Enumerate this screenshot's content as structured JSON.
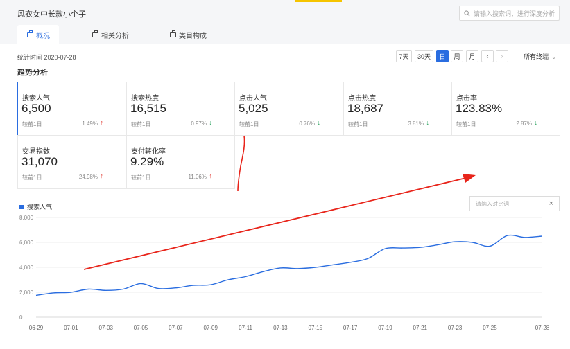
{
  "header": {
    "title": "风衣女中长款小个子",
    "search_placeholder": "请输入搜索词，进行深度分析"
  },
  "tabs": [
    {
      "label": "概况",
      "active": true
    },
    {
      "label": "相关分析",
      "active": false
    },
    {
      "label": "类目构成",
      "active": false
    }
  ],
  "datebar": {
    "stat_time": "统计时间 2020-07-28",
    "buttons": [
      "7天",
      "30天",
      "日",
      "周",
      "月"
    ],
    "active_button": "日",
    "prev": "‹",
    "next": "›",
    "terminal": "所有终端"
  },
  "section_title": "趋势分析",
  "cards": [
    {
      "label": "搜索人气",
      "value": "6,500",
      "cmp": "较前1日",
      "pct": "1.49%",
      "dir": "up",
      "selected": true
    },
    {
      "label": "搜索热度",
      "value": "16,515",
      "cmp": "较前1日",
      "pct": "0.97%",
      "dir": "down"
    },
    {
      "label": "点击人气",
      "value": "5,025",
      "cmp": "较前1日",
      "pct": "0.76%",
      "dir": "down"
    },
    {
      "label": "点击热度",
      "value": "18,687",
      "cmp": "较前1日",
      "pct": "3.81%",
      "dir": "down"
    },
    {
      "label": "点击率",
      "value": "123.83%",
      "cmp": "较前1日",
      "pct": "2.87%",
      "dir": "down"
    },
    {
      "label": "交易指数",
      "value": "31,070",
      "cmp": "较前1日",
      "pct": "24.98%",
      "dir": "up"
    },
    {
      "label": "支付转化率",
      "value": "9.29%",
      "cmp": "较前1日",
      "pct": "11.06%",
      "dir": "up"
    }
  ],
  "compare_placeholder": "请输入对比词",
  "compare_clear": "×",
  "colors": {
    "accent": "#2a6de0",
    "up": "#e0322a",
    "down": "#1f9d55",
    "annotation": "#e8241a"
  },
  "chart_data": {
    "type": "line",
    "title": "",
    "xlabel": "",
    "ylabel": "",
    "ylim": [
      0,
      8000
    ],
    "yticks": [
      "0",
      "2,000",
      "4,000",
      "6,000",
      "8,000"
    ],
    "xticks": [
      "06-29",
      "07-01",
      "07-03",
      "07-05",
      "07-07",
      "07-09",
      "07-11",
      "07-13",
      "07-15",
      "07-17",
      "07-19",
      "07-21",
      "07-23",
      "07-25",
      "07-28"
    ],
    "grid": true,
    "legend_position": "top-left",
    "series": [
      {
        "name": "搜索人气",
        "x": [
          "06-29",
          "06-30",
          "07-01",
          "07-02",
          "07-03",
          "07-04",
          "07-05",
          "07-06",
          "07-07",
          "07-08",
          "07-09",
          "07-10",
          "07-11",
          "07-12",
          "07-13",
          "07-14",
          "07-15",
          "07-16",
          "07-17",
          "07-18",
          "07-19",
          "07-20",
          "07-21",
          "07-22",
          "07-23",
          "07-24",
          "07-25",
          "07-26",
          "07-27",
          "07-28"
        ],
        "values": [
          1750,
          1950,
          2000,
          2250,
          2150,
          2250,
          2700,
          2300,
          2350,
          2550,
          2600,
          3000,
          3250,
          3650,
          3950,
          3900,
          4000,
          4200,
          4400,
          4700,
          5500,
          5550,
          5600,
          5800,
          6050,
          6000,
          5700,
          6550,
          6400,
          6500
        ]
      }
    ]
  }
}
